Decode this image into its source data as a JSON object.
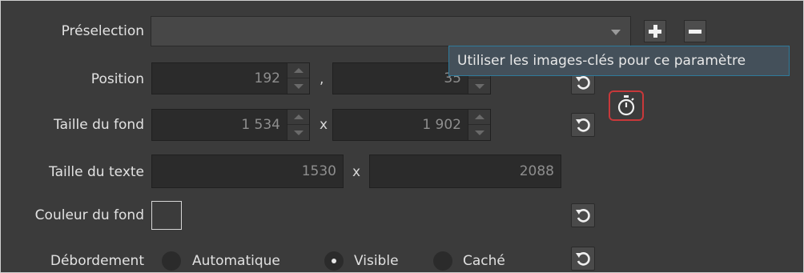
{
  "preselection": {
    "label": "Préselection",
    "value": ""
  },
  "position": {
    "label": "Position",
    "x": "192",
    "separator": ",",
    "y": "35"
  },
  "taille_fond": {
    "label": "Taille du fond",
    "w": "1 534",
    "separator": "x",
    "h": "1 902"
  },
  "taille_texte": {
    "label": "Taille du texte",
    "w": "1530",
    "separator": "x",
    "h": "2088"
  },
  "couleur_fond": {
    "label": "Couleur du fond"
  },
  "debordement": {
    "label": "Débordement",
    "options": [
      "Automatique",
      "Visible",
      "Caché"
    ],
    "selected": "Visible"
  },
  "tooltip": {
    "text": "Utiliser les images-clés pour ce paramètre"
  },
  "icons": {
    "add": "plus-icon",
    "remove": "minus-icon",
    "reset": "reset-icon",
    "keyframes": "stopwatch-icon"
  },
  "colors": {
    "highlight": "#c8383a",
    "tooltip_border": "#2f7a9a"
  }
}
